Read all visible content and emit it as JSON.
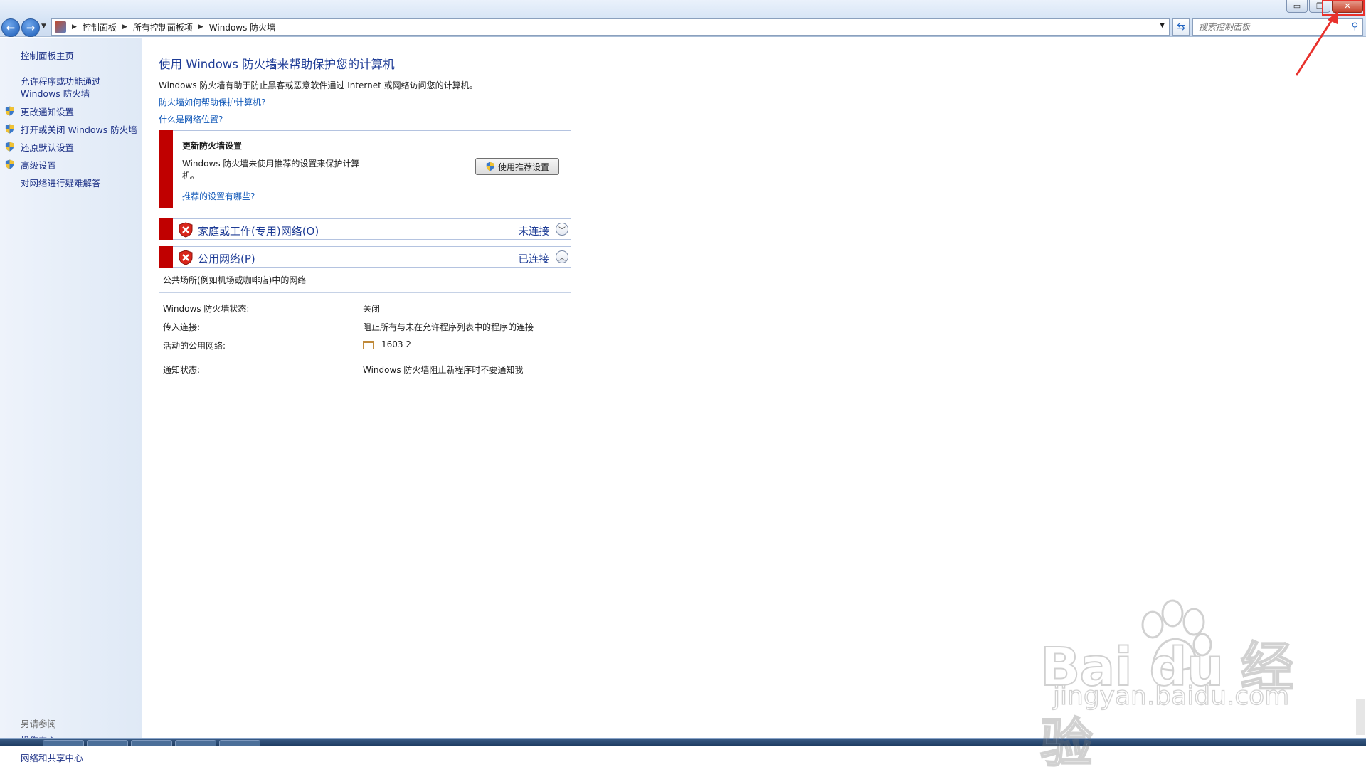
{
  "address_bar": {
    "breadcrumbs": [
      "控制面板",
      "所有控制面板项",
      "Windows 防火墙"
    ],
    "search_placeholder": "搜索控制面板"
  },
  "window_controls": {
    "minimize": "▭",
    "restore": "❐",
    "close": "✕"
  },
  "sidebar": {
    "items": [
      {
        "label": "控制面板主页",
        "shield": false
      },
      {
        "label": "允许程序或功能通过 Windows 防火墙",
        "shield": false
      },
      {
        "label": "更改通知设置",
        "shield": true
      },
      {
        "label": "打开或关闭 Windows 防火墙",
        "shield": true
      },
      {
        "label": "还原默认设置",
        "shield": true
      },
      {
        "label": "高级设置",
        "shield": true
      },
      {
        "label": "对网络进行疑难解答",
        "shield": false
      }
    ],
    "see_also_title": "另请参阅",
    "see_also": [
      "操作中心",
      "网络和共享中心"
    ]
  },
  "main": {
    "title": "使用 Windows 防火墙来帮助保护您的计算机",
    "description": "Windows 防火墙有助于防止黑客或恶意软件通过 Internet 或网络访问您的计算机。",
    "link_how": "防火墙如何帮助保护计算机?",
    "link_location": "什么是网络位置?"
  },
  "update_panel": {
    "title": "更新防火墙设置",
    "text": "Windows 防火墙未使用推荐的设置来保护计算机。",
    "link": "推荐的设置有哪些?",
    "button": "使用推荐设置"
  },
  "networks": [
    {
      "name": "家庭或工作(专用)网络(O)",
      "status": "未连接",
      "expanded": false
    },
    {
      "name": "公用网络(P)",
      "status": "已连接",
      "expanded": true
    }
  ],
  "public_details": {
    "subtitle": "公共场所(例如机场或咖啡店)中的网络",
    "rows": [
      {
        "label": "Windows 防火墙状态:",
        "value": "关闭"
      },
      {
        "label": "传入连接:",
        "value": "阻止所有与未在允许程序列表中的程序的连接"
      },
      {
        "label": "活动的公用网络:",
        "value": "1603  2"
      },
      {
        "label": "通知状态:",
        "value": "Windows 防火墙阻止新程序时不要通知我"
      }
    ]
  },
  "watermark": {
    "brand": "Bai du 经验",
    "url": "jingyan.baidu.com"
  },
  "colors": {
    "accent_red": "#c00000",
    "link_blue": "#0f57b8",
    "title_blue": "#1e3c96",
    "annotation": "#e8312c"
  }
}
